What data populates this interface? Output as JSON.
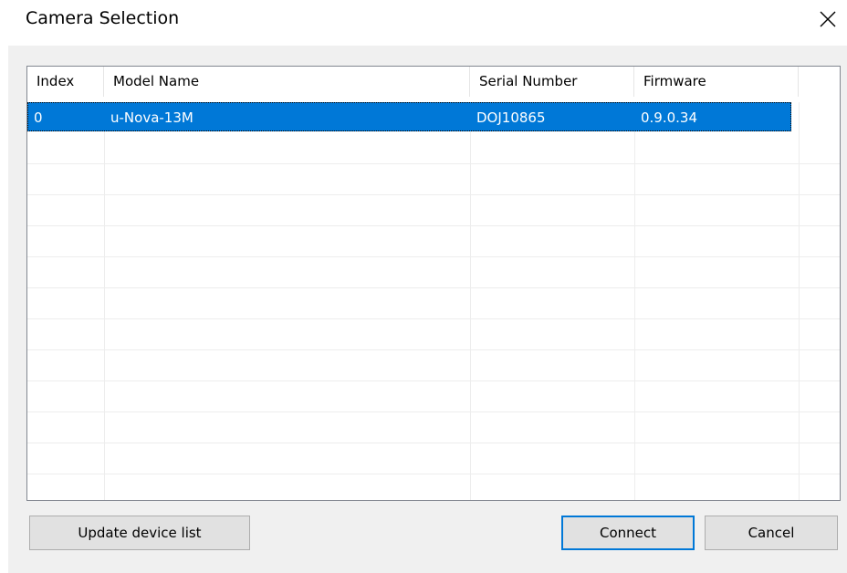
{
  "window": {
    "title": "Camera Selection",
    "close_icon": "close-icon"
  },
  "device_list": {
    "columns": [
      "Index",
      "Model Name",
      "Serial Number",
      "Firmware"
    ],
    "rows": [
      {
        "index": "0",
        "model_name": "u-Nova-13M",
        "serial_number": "DOJ10865",
        "firmware": "0.9.0.34",
        "selected": true
      }
    ]
  },
  "buttons": {
    "update_label": "Update device list",
    "connect_label": "Connect",
    "cancel_label": "Cancel"
  },
  "colors": {
    "selection": "#0078d7",
    "dialog_bg": "#f0f0f0",
    "default_button_border": "#0078d7"
  }
}
